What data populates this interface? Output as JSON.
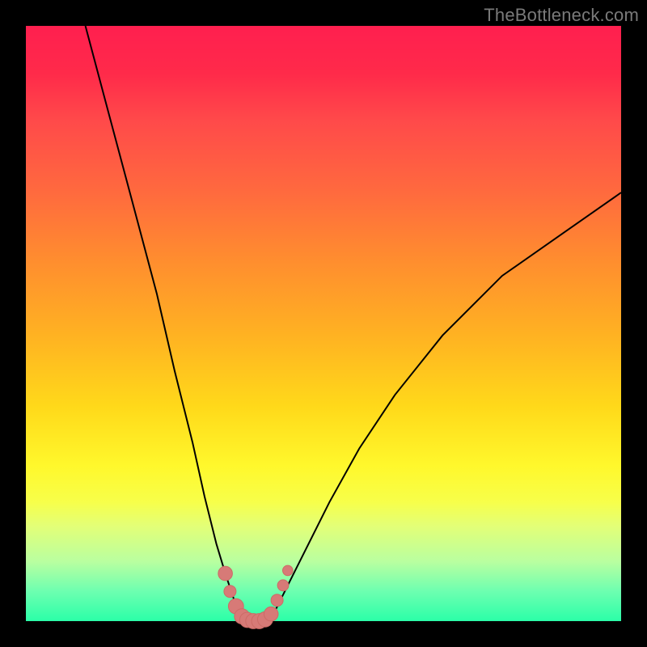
{
  "watermark": {
    "text": "TheBottleneck.com"
  },
  "colors": {
    "frame": "#000000",
    "curve_stroke": "#000000",
    "marker_fill": "#d77a77",
    "marker_stroke": "#cc6b66",
    "gradient_top": "#ff1f4f",
    "gradient_bottom": "#2bffa8"
  },
  "chart_data": {
    "type": "line",
    "title": "",
    "xlabel": "",
    "ylabel": "",
    "xlim": [
      0,
      100
    ],
    "ylim": [
      0,
      100
    ],
    "grid": false,
    "legend": false,
    "note": "Values estimated from pixel position; axes not labeled in source image.",
    "series": [
      {
        "name": "left-curve",
        "x": [
          10,
          14,
          18,
          22,
          25,
          28,
          30,
          32,
          33.5,
          34.5,
          35.5,
          36.5
        ],
        "y": [
          100,
          85,
          70,
          55,
          42,
          30,
          21,
          13,
          8,
          5,
          2,
          0
        ]
      },
      {
        "name": "right-curve",
        "x": [
          41,
          42,
          44,
          47,
          51,
          56,
          62,
          70,
          80,
          90,
          100
        ],
        "y": [
          0,
          2,
          6,
          12,
          20,
          29,
          38,
          48,
          58,
          65,
          72
        ]
      },
      {
        "name": "valley-floor",
        "x": [
          36.5,
          38,
          39.5,
          41
        ],
        "y": [
          0,
          0,
          0,
          0
        ]
      }
    ],
    "markers": [
      {
        "x": 33.5,
        "y": 8,
        "r": 1.4
      },
      {
        "x": 34.3,
        "y": 5,
        "r": 1.2
      },
      {
        "x": 35.3,
        "y": 2.5,
        "r": 1.5
      },
      {
        "x": 36.3,
        "y": 0.8,
        "r": 1.5
      },
      {
        "x": 37.2,
        "y": 0.2,
        "r": 1.5
      },
      {
        "x": 38.2,
        "y": 0,
        "r": 1.5
      },
      {
        "x": 39.2,
        "y": 0,
        "r": 1.5
      },
      {
        "x": 40.2,
        "y": 0.3,
        "r": 1.5
      },
      {
        "x": 41.2,
        "y": 1.2,
        "r": 1.4
      },
      {
        "x": 42.2,
        "y": 3.5,
        "r": 1.2
      },
      {
        "x": 43.2,
        "y": 6,
        "r": 1.1
      },
      {
        "x": 44.0,
        "y": 8.5,
        "r": 1.0
      }
    ]
  }
}
